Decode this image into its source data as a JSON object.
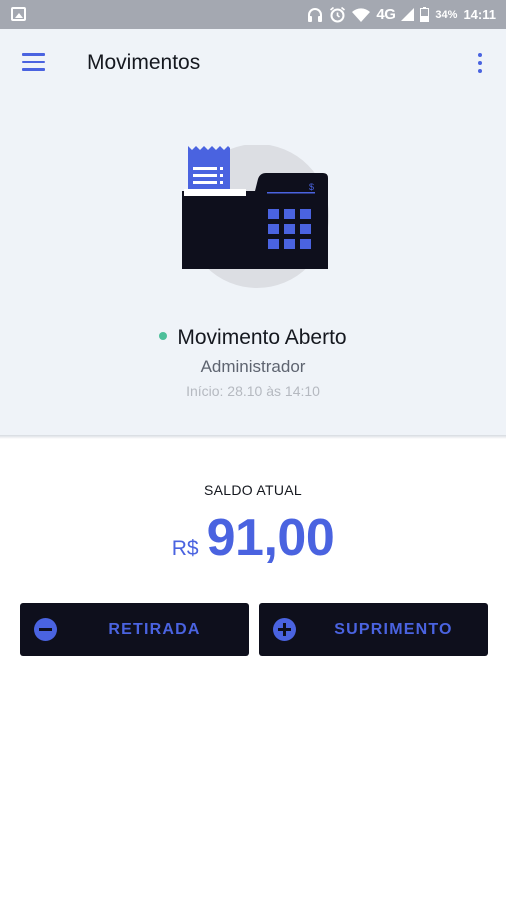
{
  "status_bar": {
    "battery": "34%",
    "time": "14:11",
    "network": "4G",
    "icons": [
      "image-icon",
      "headphones-icon",
      "alarm-icon",
      "wifi-icon",
      "signal-icon",
      "battery-icon"
    ]
  },
  "app_bar": {
    "title": "Movimentos",
    "icons": [
      "menu-icon",
      "more-vert-icon"
    ]
  },
  "movement": {
    "status": "Movimento Aberto",
    "status_color": "#4cbf9a",
    "user": "Administrador",
    "since": "Início: 28.10 às 14:10"
  },
  "balance": {
    "label": "SALDO ATUAL",
    "currency": "R$",
    "amount": "91,00"
  },
  "actions": {
    "withdraw_label": "RETIRADA",
    "supply_label": "SUPRIMENTO"
  },
  "colors": {
    "accent": "#4a63e0",
    "button_bg": "#0e0f1c",
    "header_bg": "#eff3f8"
  }
}
